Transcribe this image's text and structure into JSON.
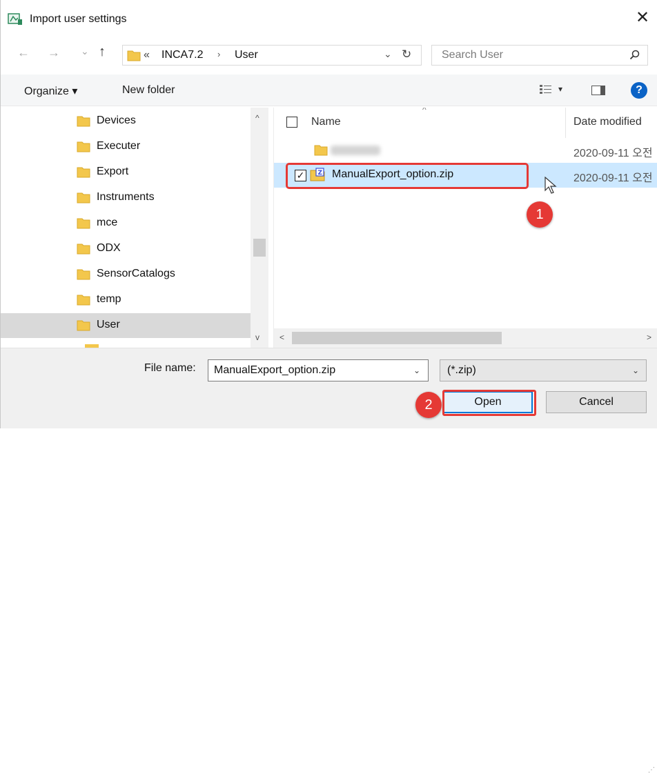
{
  "window": {
    "title": "Import user settings",
    "close_glyph": "✕",
    "icons": {
      "app": "app-icon",
      "close": "close-icon"
    }
  },
  "navigation": {
    "back_glyph": "←",
    "forward_glyph": "→",
    "recent_glyph": "⌄",
    "up_glyph": "↑",
    "address": {
      "overflow_glyph": "«",
      "segments": [
        "INCA7.2",
        "User"
      ],
      "separator": "›",
      "dropdown_glyph": "⌄",
      "refresh_glyph": "↻"
    },
    "search": {
      "placeholder": "Search User"
    }
  },
  "toolbar": {
    "organize_label": "Organize ▾",
    "new_folder_label": "New folder",
    "view_dropdown_glyph": "▾",
    "help_glyph": "?"
  },
  "tree": {
    "items": [
      {
        "label": "Devices",
        "selected": false
      },
      {
        "label": "Executer",
        "selected": false
      },
      {
        "label": "Export",
        "selected": false
      },
      {
        "label": "Instruments",
        "selected": false
      },
      {
        "label": "mce",
        "selected": false
      },
      {
        "label": "ODX",
        "selected": false
      },
      {
        "label": "SensorCatalogs",
        "selected": false
      },
      {
        "label": "temp",
        "selected": false
      },
      {
        "label": "User",
        "selected": true
      }
    ],
    "scroll_up_glyph": "^",
    "scroll_down_glyph": "v"
  },
  "file_list": {
    "columns": {
      "name": "Name",
      "date_modified": "Date modified",
      "sort_glyph": "^"
    },
    "rows": [
      {
        "type": "folder",
        "name_blurred": true,
        "date": "2020-09-11 오전"
      },
      {
        "type": "zip",
        "name": "ManualExport_option.zip",
        "date": "2020-09-11 오전",
        "selected": true,
        "checked": true,
        "check_glyph": "✓"
      }
    ],
    "hscroll_left_glyph": "<",
    "hscroll_right_glyph": ">"
  },
  "bottom": {
    "file_name_label": "File name:",
    "file_name_value": "ManualExport_option.zip",
    "file_name_dropdown_glyph": "⌄",
    "file_type_value": "(*.zip)",
    "file_type_dropdown_glyph": "⌄",
    "open_label": "Open",
    "cancel_label": "Cancel"
  },
  "annotations": {
    "step1": "1",
    "step2": "2",
    "color": "#e53935"
  },
  "colors": {
    "selection": "#cce8ff",
    "tree_selection": "#d9d9d9",
    "accent": "#0078d7",
    "folder": "#f3c74c"
  }
}
